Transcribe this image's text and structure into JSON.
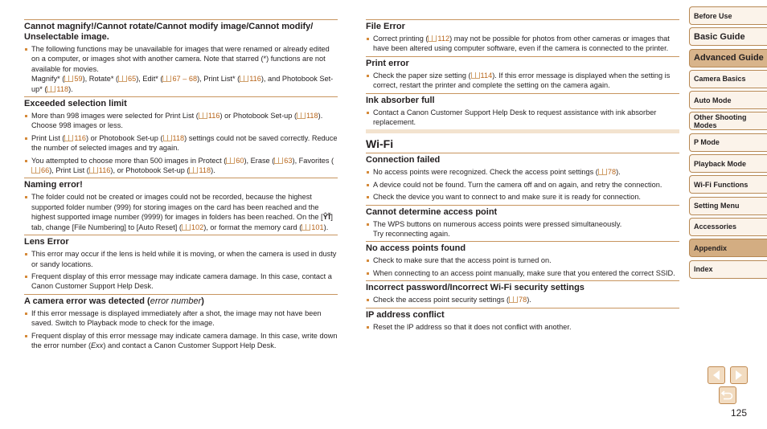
{
  "left_sections": [
    {
      "title": "Cannot magnify!/Cannot rotate/Cannot modify image/Cannot modify/ Unselectable image.",
      "items": [
        [
          {
            "t": "The following functions may be unavailable for images that were renamed or already edited on a computer, or images shot with another camera. Note that starred (*) functions are not available for movies."
          },
          {
            "br": true
          },
          {
            "t": "Magnify* ("
          },
          {
            "ref": "59"
          },
          {
            "t": "), Rotate* ("
          },
          {
            "ref": "65"
          },
          {
            "t": "), Edit* ("
          },
          {
            "ref": "67 – 68"
          },
          {
            "t": "), Print List* ("
          },
          {
            "ref": "116"
          },
          {
            "t": "), and Photobook Set-up* ("
          },
          {
            "ref": "118"
          },
          {
            "t": ")."
          }
        ]
      ]
    },
    {
      "title": "Exceeded selection limit",
      "items": [
        [
          {
            "t": "More than 998 images were selected for Print List ("
          },
          {
            "ref": "116"
          },
          {
            "t": ") or Photobook Set-up ("
          },
          {
            "ref": "118"
          },
          {
            "t": "). Choose 998 images or less."
          }
        ],
        [
          {
            "t": "Print List ("
          },
          {
            "ref": "116"
          },
          {
            "t": ") or Photobook Set-up ("
          },
          {
            "ref": "118"
          },
          {
            "t": ") settings could not be saved correctly. Reduce the number of selected images and try again."
          }
        ],
        [
          {
            "t": "You attempted to choose more than 500 images in Protect ("
          },
          {
            "ref": "60"
          },
          {
            "t": "), Erase ("
          },
          {
            "ref": "63"
          },
          {
            "t": "), Favorites ("
          },
          {
            "ref": "66"
          },
          {
            "t": "), Print List ("
          },
          {
            "ref": "116"
          },
          {
            "t": "), or Photobook Set-up ("
          },
          {
            "ref": "118"
          },
          {
            "t": ")."
          }
        ]
      ]
    },
    {
      "title": "Naming error!",
      "items": [
        [
          {
            "t": "The folder could not be created or images could not be recorded, because the highest supported folder number (999) for storing images on the card has been reached and the highest supported image number (9999) for images in folders has been reached. On the ["
          },
          {
            "tab": "ŶŤ"
          },
          {
            "t": "] tab, change [File Numbering] to [Auto Reset] ("
          },
          {
            "ref": "102"
          },
          {
            "t": "), or format the memory card ("
          },
          {
            "ref": "101"
          },
          {
            "t": ")."
          }
        ]
      ]
    },
    {
      "title": "Lens Error",
      "items": [
        [
          {
            "t": "This error may occur if the lens is held while it is moving, or when the camera is used in dusty or sandy locations."
          }
        ],
        [
          {
            "t": "Frequent display of this error message may indicate camera damage. In this case, contact a Canon Customer Support Help Desk."
          }
        ]
      ]
    },
    {
      "title": "A camera error was detected (",
      "title_italic": "error number",
      "title_end": ")",
      "items": [
        [
          {
            "t": "If this error message is displayed immediately after a shot, the image may not have been saved. Switch to Playback mode to check for the image."
          }
        ],
        [
          {
            "t": "Frequent display of this error message may indicate camera damage. In this case, write down the error number ("
          },
          {
            "i": "Exx"
          },
          {
            "t": ") and contact a Canon Customer Support Help Desk."
          }
        ]
      ]
    }
  ],
  "right_sections_top": [
    {
      "title": "File Error",
      "items": [
        [
          {
            "t": "Correct printing ("
          },
          {
            "ref": "112"
          },
          {
            "t": ") may not be possible for photos from other cameras or images that have been altered using computer software, even if the camera is connected to the printer."
          }
        ]
      ]
    },
    {
      "title": "Print error",
      "items": [
        [
          {
            "t": "Check the paper size setting ("
          },
          {
            "ref": "114"
          },
          {
            "t": "). If this error message is displayed when the setting is correct, restart the printer and complete the setting on the camera again."
          }
        ]
      ]
    },
    {
      "title": "Ink absorber full",
      "items": [
        [
          {
            "t": "Contact a Canon Customer Support Help Desk to request assistance with ink absorber replacement."
          }
        ]
      ]
    }
  ],
  "wifi_heading": "Wi-Fi",
  "right_sections_wifi": [
    {
      "title": "Connection failed",
      "items": [
        [
          {
            "t": "No access points were recognized. Check the access point settings ("
          },
          {
            "ref": "78"
          },
          {
            "t": ")."
          }
        ],
        [
          {
            "t": "A device could not be found. Turn the camera off and on again, and retry the connection."
          }
        ],
        [
          {
            "t": "Check the device you want to connect to and make sure it is ready for connection."
          }
        ]
      ]
    },
    {
      "title": "Cannot determine access point",
      "items": [
        [
          {
            "t": "The WPS buttons on numerous access points were pressed simultaneously."
          },
          {
            "br": true
          },
          {
            "t": "Try reconnecting again."
          }
        ]
      ]
    },
    {
      "title": "No access points found",
      "items": [
        [
          {
            "t": "Check to make sure that the access point is turned on."
          }
        ],
        [
          {
            "t": "When connecting to an access point manually, make sure that you entered the correct SSID."
          }
        ]
      ]
    },
    {
      "title": "Incorrect password/Incorrect Wi-Fi security settings",
      "items": [
        [
          {
            "t": "Check the access point security settings ("
          },
          {
            "ref": "78"
          },
          {
            "t": ")."
          }
        ]
      ]
    },
    {
      "title": "IP address conflict",
      "items": [
        [
          {
            "t": "Reset the IP address so that it does not conflict with another."
          }
        ]
      ]
    }
  ],
  "nav": {
    "items": [
      {
        "label": "Before Use",
        "style": ""
      },
      {
        "label": "Basic Guide",
        "style": "big"
      },
      {
        "label": "Advanced Guide",
        "style": "big active"
      },
      {
        "label": "Camera Basics",
        "style": ""
      },
      {
        "label": "Auto Mode",
        "style": ""
      },
      {
        "label": "Other Shooting Modes",
        "style": ""
      },
      {
        "label": "P Mode",
        "style": ""
      },
      {
        "label": "Playback Mode",
        "style": ""
      },
      {
        "label": "Wi-Fi Functions",
        "style": ""
      },
      {
        "label": "Setting Menu",
        "style": ""
      },
      {
        "label": "Accessories",
        "style": ""
      },
      {
        "label": "Appendix",
        "style": "active2"
      },
      {
        "label": "Index",
        "style": ""
      }
    ],
    "prev_icon": "triangle-left",
    "next_icon": "triangle-right",
    "return_icon": "return-arrow",
    "page_number": "125"
  },
  "colors": {
    "rule": "#c8955f",
    "link": "#b8661c",
    "nav_active": "#d8b48b",
    "nav_bg": "#fbf3ea"
  }
}
